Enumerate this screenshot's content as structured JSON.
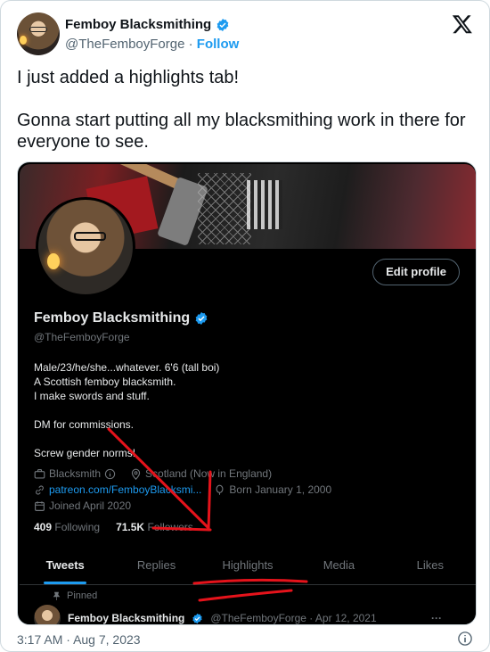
{
  "author": {
    "name": "Femboy Blacksmithing",
    "handle": "@TheFemboyForge",
    "separator": "·",
    "follow_label": "Follow"
  },
  "tweet": {
    "text": "I just added a highlights tab!\n\nGonna start putting all my blacksmithing work in there for everyone to see.",
    "time": "3:17 AM",
    "date_sep": "·",
    "date": "Aug 7, 2023"
  },
  "screenshot": {
    "edit_profile": "Edit profile",
    "name": "Femboy Blacksmithing",
    "handle": "@TheFemboyForge",
    "bio": "Male/23/he/she...whatever. 6'6 (tall boi)\nA Scottish femboy blacksmith.\nI make swords and stuff.\n\nDM for commissions.\n\nScrew gender norms!",
    "category": "Blacksmith",
    "location": "Scotland (Now in England)",
    "link": "patreon.com/FemboyBlacksmi...",
    "born": "Born January 1, 2000",
    "joined": "Joined April 2020",
    "following_count": "409",
    "following_label": "Following",
    "followers_count": "71.5K",
    "followers_label": "Followers",
    "tabs": [
      "Tweets",
      "Replies",
      "Highlights",
      "Media",
      "Likes"
    ],
    "pinned_label": "Pinned",
    "post_name": "Femboy Blacksmithing",
    "post_meta": "@TheFemboyForge · Apr 12, 2021",
    "post_more": "···"
  },
  "colors": {
    "accent": "#1d9bf0",
    "annotation": "#e5131b",
    "dark_bg": "#000000"
  },
  "icons": [
    "x-logo-icon",
    "verified-badge-icon",
    "briefcase-icon",
    "location-pin-icon",
    "link-icon",
    "balloon-icon",
    "calendar-icon",
    "pin-icon",
    "info-icon"
  ]
}
